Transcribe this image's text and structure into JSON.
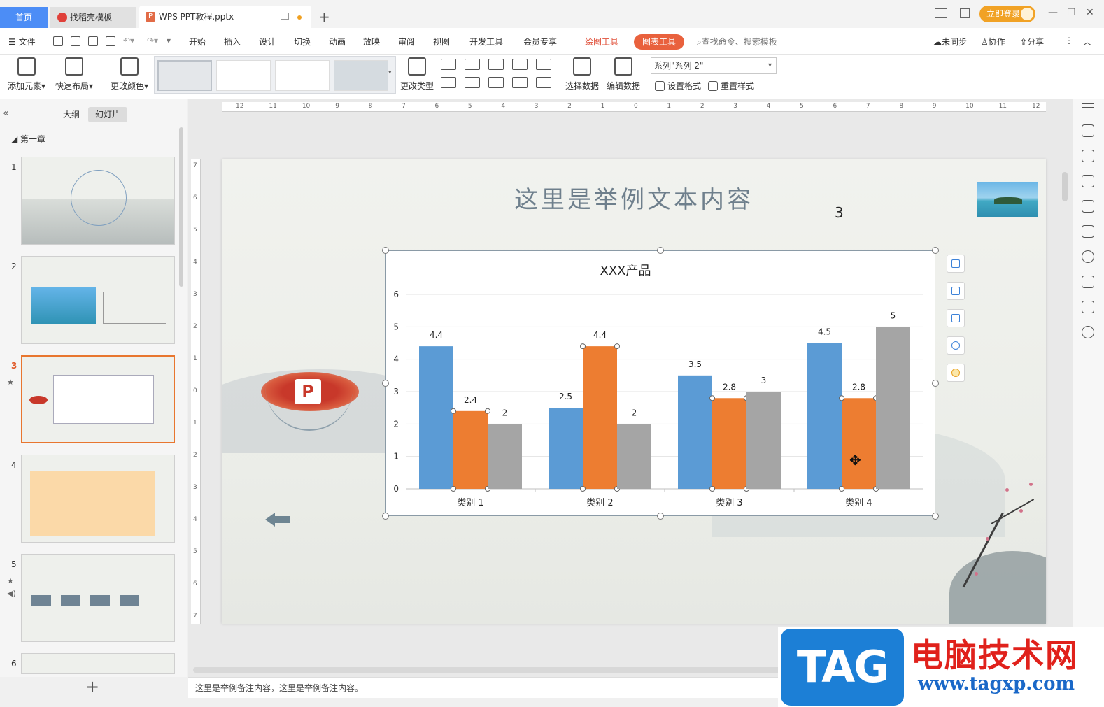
{
  "titlebar": {
    "home_tab": "首页",
    "template_tab": "找稻壳模板",
    "doc_tab": "WPS PPT教程.pptx",
    "login_button": "立即登录",
    "minimize": "—",
    "maximize": "☐",
    "close": "✕",
    "add_tab": "+"
  },
  "menu": {
    "file": "文件",
    "items": [
      "开始",
      "插入",
      "设计",
      "切换",
      "动画",
      "放映",
      "审阅",
      "视图",
      "开发工具",
      "会员专享"
    ],
    "drawing_tools": "绘图工具",
    "chart_tools": "图表工具",
    "search_placeholder": "查找命令、搜索模板",
    "sync": "未同步",
    "collab": "协作",
    "share": "分享"
  },
  "ribbon": {
    "add_element": "添加元素",
    "quick_layout": "快速布局",
    "change_color": "更改颜色",
    "change_type": "更改类型",
    "select_data": "选择数据",
    "edit_data": "编辑数据",
    "series_selected": "系列\"系列 2\"",
    "set_format": "设置格式",
    "reset_style": "重置样式"
  },
  "left_panel": {
    "outline_tab": "大纲",
    "slides_tab": "幻灯片",
    "chapter": "第一章",
    "slide_numbers": [
      "1",
      "2",
      "3",
      "4",
      "5",
      "6"
    ],
    "add_slide": "+"
  },
  "slide": {
    "title": "这里是举例文本内容",
    "number_text": "3"
  },
  "chart_data": {
    "type": "bar",
    "title": "XXX产品",
    "categories": [
      "类别 1",
      "类别 2",
      "类别 3",
      "类别 4"
    ],
    "series": [
      {
        "values": [
          4.4,
          2.5,
          3.5,
          4.5
        ],
        "color": "#5b9bd5"
      },
      {
        "values": [
          2.4,
          4.4,
          2.8,
          2.8
        ],
        "color": "#ed7d31"
      },
      {
        "values": [
          2,
          2,
          3,
          5
        ],
        "color": "#a5a5a5"
      }
    ],
    "ylim": [
      0,
      6
    ],
    "yticks": [
      "0",
      "1",
      "2",
      "3",
      "4",
      "5",
      "6"
    ],
    "grid": true,
    "legend": "none",
    "selected_series_index": 1
  },
  "notes": {
    "text": "这里是举例备注内容，这里是举例备注内容。"
  },
  "watermark": {
    "tag": "TAG",
    "name": "电脑技术网",
    "url": "www.tagxp.com"
  },
  "ruler": {
    "h_labels": [
      "12",
      "11",
      "10",
      "9",
      "8",
      "7",
      "6",
      "5",
      "4",
      "3",
      "2",
      "1",
      "0",
      "1",
      "2",
      "3",
      "4",
      "5",
      "6",
      "7",
      "8",
      "9",
      "10",
      "11",
      "12"
    ],
    "v_labels": [
      "7",
      "6",
      "5",
      "4",
      "3",
      "2",
      "1",
      "0",
      "1",
      "2",
      "3",
      "4",
      "5",
      "6",
      "7"
    ]
  }
}
